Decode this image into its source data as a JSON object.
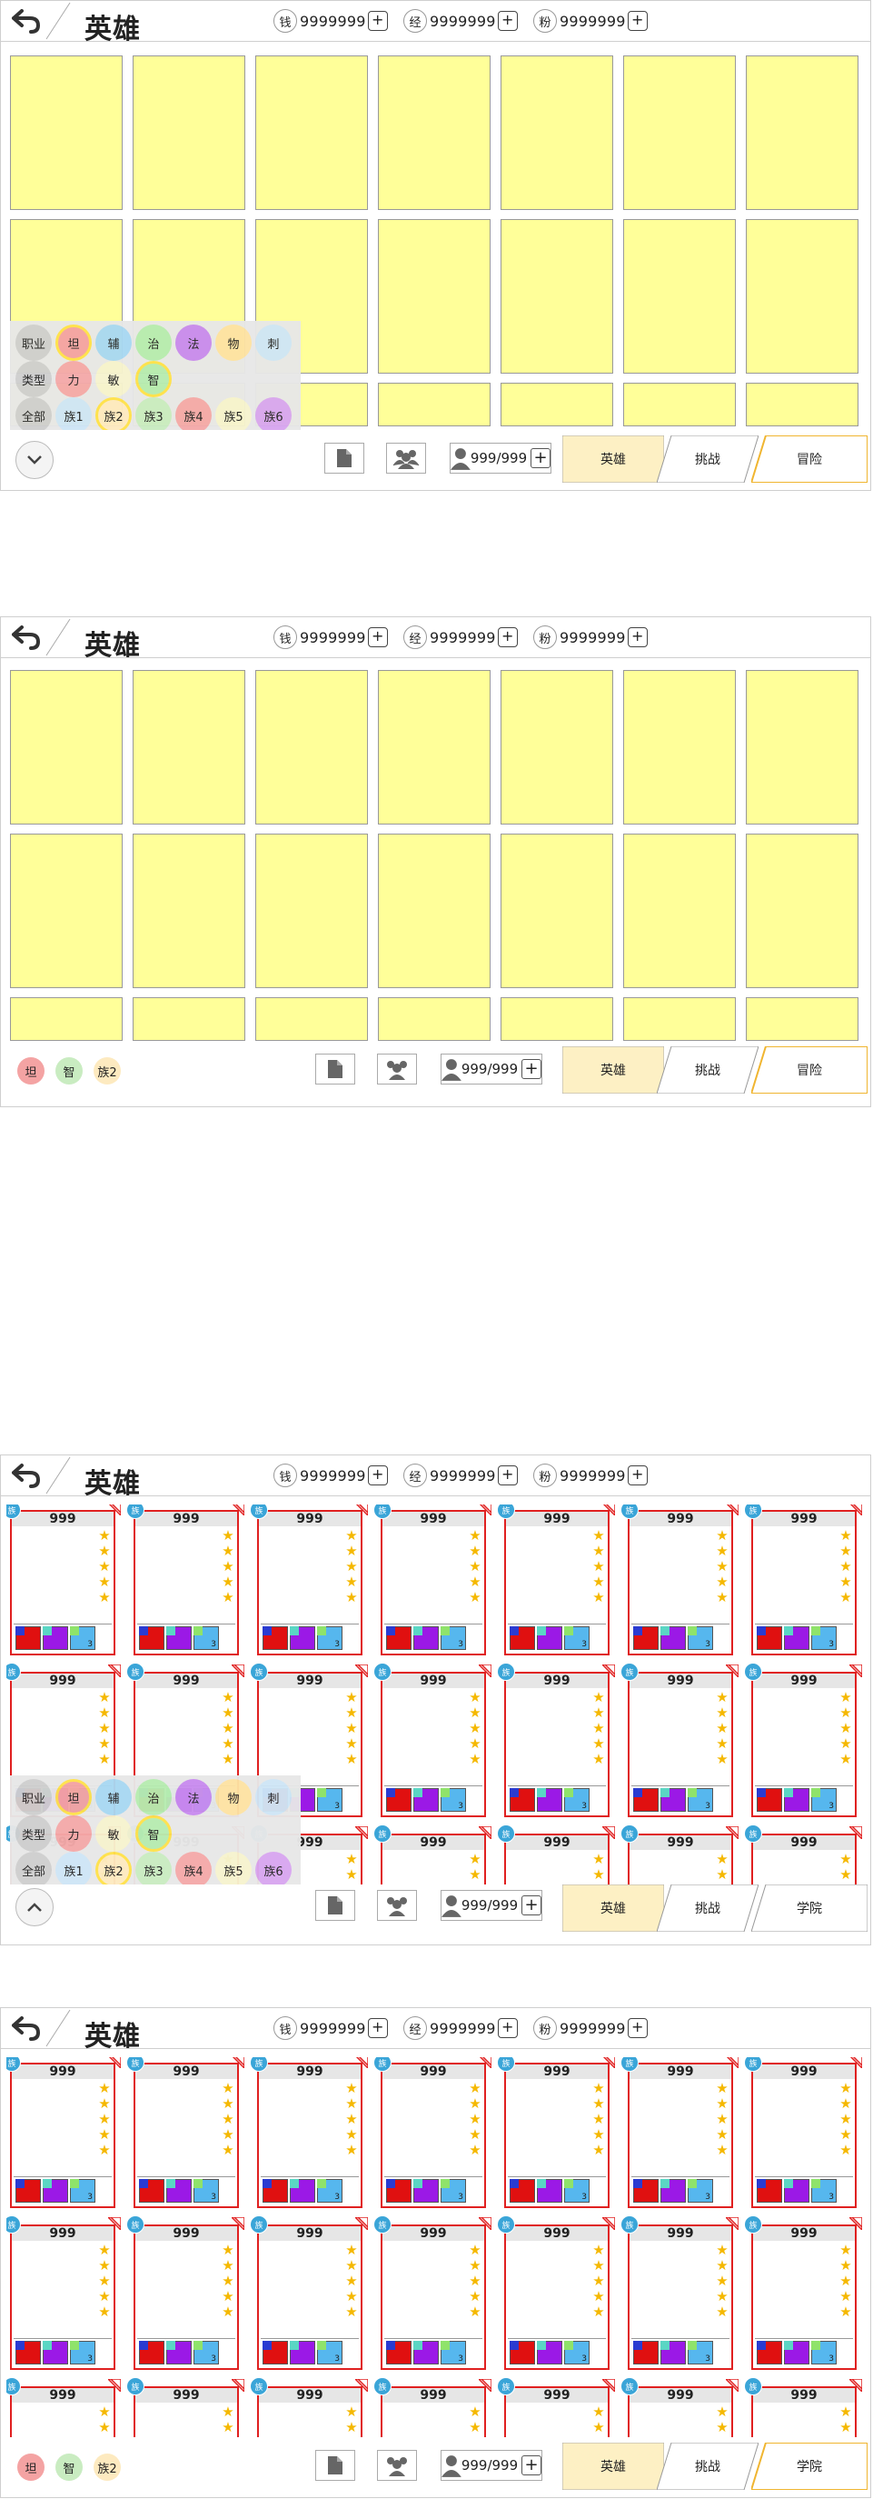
{
  "header": {
    "title": "英雄",
    "resources": [
      {
        "icon": "钱",
        "value": "9999999",
        "plus": "+"
      },
      {
        "icon": "经",
        "value": "9999999",
        "plus": "+"
      },
      {
        "icon": "粉",
        "value": "9999999",
        "plus": "+"
      }
    ]
  },
  "bottom": {
    "roster_count": "999/999",
    "roster_plus": "+",
    "tabs_a": [
      "英雄",
      "挑战",
      "冒险"
    ],
    "tabs_b": [
      "英雄",
      "挑战",
      "学院"
    ]
  },
  "filter": {
    "row1": [
      "职业",
      "坦",
      "辅",
      "治",
      "法",
      "物",
      "刺"
    ],
    "row2": [
      "类型",
      "力",
      "敏",
      "智"
    ],
    "row3": [
      "全部",
      "族1",
      "族2",
      "族3",
      "族4",
      "族5",
      "族6"
    ]
  },
  "selected_filters": [
    "坦",
    "智",
    "族2"
  ],
  "card": {
    "cost": "999",
    "badge": "族",
    "level": "3",
    "stars": 5
  },
  "colors": {
    "tile": "#ffff99",
    "active_tab": "#fdf0c4",
    "card_border": "#e02020",
    "star": "#f5b800",
    "elem_red": "#e01010",
    "elem_purple": "#9b19e6",
    "elem_blue": "#56b7ee"
  },
  "icons": [
    "back-arrow-icon",
    "document-icon",
    "team-icon",
    "person-icon",
    "chevron-down-icon",
    "chevron-up-icon"
  ]
}
